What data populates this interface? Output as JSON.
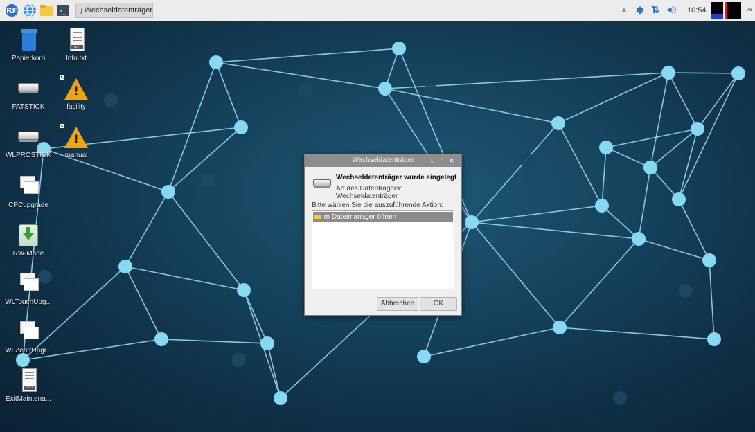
{
  "taskbar": {
    "launcher_icons": [
      "raspberry-menu-icon",
      "web-browser-icon",
      "file-manager-icon",
      "terminal-icon"
    ],
    "task_window_title": "Wechseldatenträger",
    "tray": {
      "eject_glyph": "▲",
      "bluetooth_glyph": "✱",
      "network_glyph": "⇅",
      "volume_glyph": "◀))",
      "clock": "10:54",
      "cpu_label": "78"
    }
  },
  "desktop": {
    "icons": [
      {
        "label": "Papierkorb",
        "icon": "trash-icon"
      },
      {
        "label": "Info.txt",
        "icon": "text-file-icon"
      },
      {
        "label": "FATSTICK",
        "icon": "drive-icon"
      },
      {
        "label": "facility",
        "icon": "warning-icon"
      },
      {
        "label": "WLPROSTICK",
        "icon": "drive-icon"
      },
      {
        "label": "manual",
        "icon": "warning-icon"
      },
      {
        "label": "CPCupgrade",
        "icon": "folder-window-icon"
      },
      {
        "label": "RW-Mode",
        "icon": "rw-mode-icon"
      },
      {
        "label": "WLTouchUpg...",
        "icon": "folder-window-icon"
      },
      {
        "label": "WLZentrUpgr...",
        "icon": "folder-window-icon"
      },
      {
        "label": "ExitMaintena...",
        "icon": "text-file-icon"
      }
    ]
  },
  "dialog": {
    "title": "Wechseldatenträger",
    "controls": [
      "⌄",
      "⌃",
      "✕"
    ],
    "heading": "Wechseldatenträger wurde eingelegt",
    "type_label": "Art des Datenträgers:",
    "type_value": "Wechseldatenträger",
    "prompt": "Bitte wählen Sie die auszuführende Aktion:",
    "actions": [
      "Im Dateimanager öffnen"
    ],
    "cancel_label": "Abbrechen",
    "ok_label": "OK"
  },
  "colors": {
    "accent_blue": "#2a6fc9",
    "node_color": "#7fd6f2",
    "taskbar_bg": "#ececec",
    "dialog_title_bg": "#8e8e8e"
  }
}
